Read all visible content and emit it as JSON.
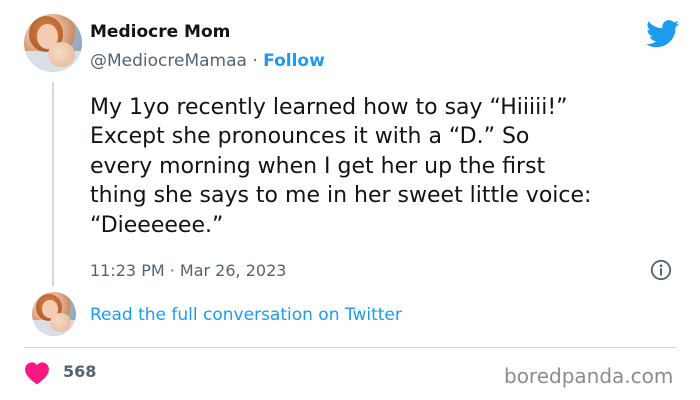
{
  "author": {
    "display_name": "Mediocre Mom",
    "handle": "@MediocreMamaa",
    "separator": " · ",
    "follow_label": "Follow"
  },
  "tweet": {
    "text": "My 1yo recently learned how to say “Hiiiii!”\nExcept she pronounces it with a “D.” So\nevery morning when I get her up  the first\nthing she says to me in her sweet little voice:\n“Dieeeeee.”",
    "timestamp": "11:23 PM · Mar 26, 2023",
    "likes": "568"
  },
  "conversation": {
    "read_link": "Read the full conversation on Twitter"
  },
  "watermark": "boredpanda.com",
  "icons": {
    "brand": "twitter-bird-icon",
    "info": "info-icon",
    "like": "heart-icon"
  },
  "colors": {
    "accent": "#1d9bf0",
    "like": "#f91880",
    "secondary_text": "#536471",
    "text": "#0f1419",
    "divider": "#cfd9de"
  }
}
